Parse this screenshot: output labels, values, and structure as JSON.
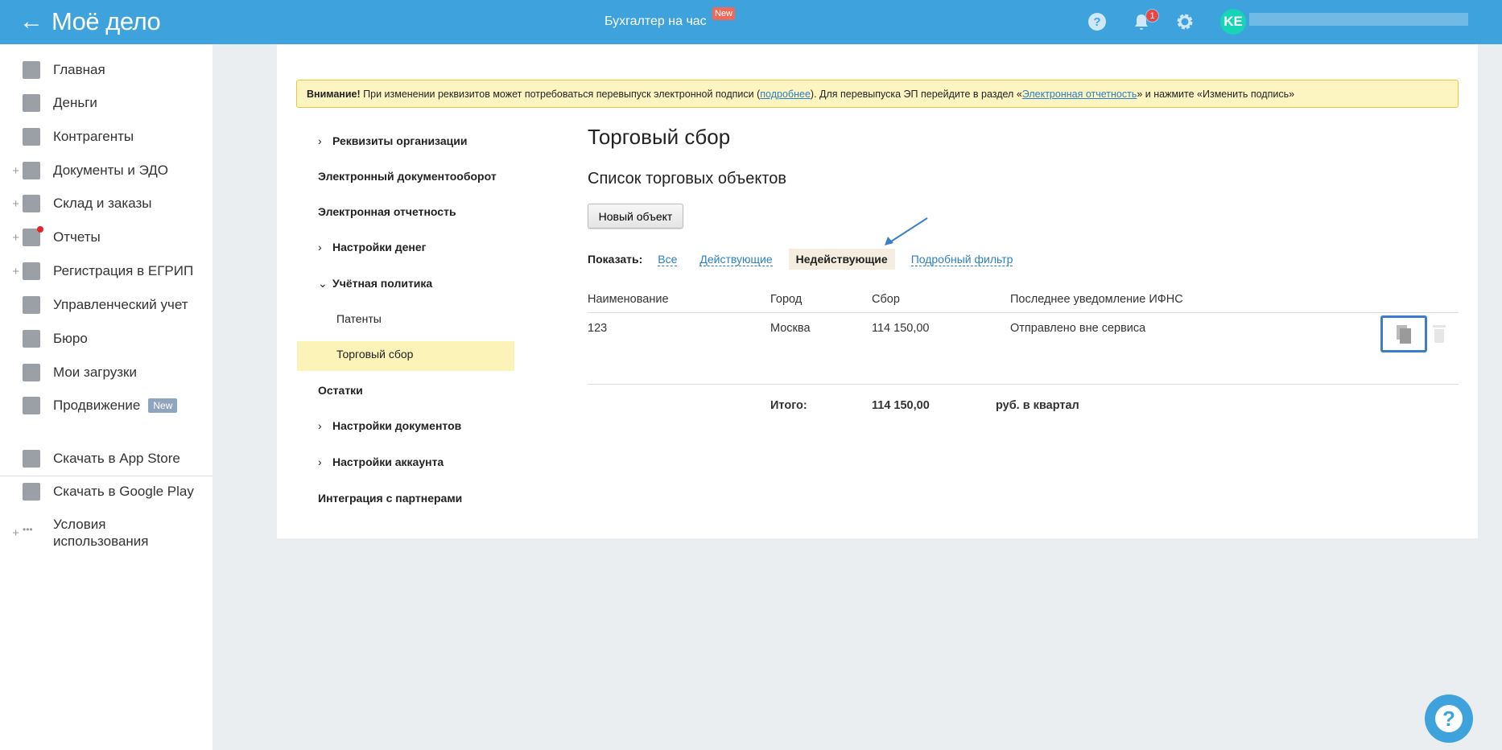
{
  "header": {
    "back": "←",
    "logo": "Моё дело",
    "center_link": "Бухгалтер на час",
    "center_badge": "New",
    "notifications_count": "1",
    "avatar_initials": "KE"
  },
  "sidebar": {
    "items": [
      {
        "label": "Главная",
        "icon": "home-icon",
        "expandable": false
      },
      {
        "label": "Деньги",
        "icon": "money-icon",
        "expandable": false
      },
      {
        "label": "Контрагенты",
        "icon": "contractors-icon",
        "expandable": false
      },
      {
        "label": "Документы и ЭДО",
        "icon": "folder-icon",
        "expandable": true
      },
      {
        "label": "Склад и заказы",
        "icon": "cart-icon",
        "expandable": true
      },
      {
        "label": "Отчеты",
        "icon": "reports-icon",
        "expandable": true
      },
      {
        "label": "Регистрация в ЕГРИП",
        "icon": "registration-icon",
        "expandable": true
      },
      {
        "label": "Управленческий учет",
        "icon": "management-icon",
        "expandable": false
      },
      {
        "label": "Бюро",
        "icon": "briefcase-icon",
        "expandable": false
      },
      {
        "label": "Мои загрузки",
        "icon": "downloads-folder-icon",
        "expandable": false
      },
      {
        "label": "Продвижение",
        "icon": "chart-icon",
        "expandable": false,
        "badge": "New"
      }
    ],
    "bottom": [
      {
        "label": "Скачать в App Store",
        "icon": "apple-icon"
      },
      {
        "label": "Скачать в Google Play",
        "icon": "google-play-icon"
      },
      {
        "label": "Условия использования",
        "icon": "more-icon"
      }
    ],
    "plus": "+"
  },
  "warning": {
    "bold": "Внимание!",
    "text1": " При изменении реквизитов может потребоваться перевыпуск электронной подписи (",
    "link1": "подробнее",
    "text2": "). Для перевыпуска ЭП перейдите в раздел «",
    "link2": "Электронная отчетность",
    "text3": "» и нажмите «Изменить подпись»"
  },
  "settings_menu": [
    {
      "label": "Реквизиты организации",
      "chevron": "›"
    },
    {
      "label": "Электронный документооборот"
    },
    {
      "label": "Электронная отчетность"
    },
    {
      "label": "Настройки денег",
      "chevron": "›"
    },
    {
      "label": "Учётная политика",
      "chevron": "⌄"
    },
    {
      "label": "Патенты",
      "sub": true
    },
    {
      "label": "Торговый сбор",
      "sub": true,
      "active": true
    },
    {
      "label": "Остатки"
    },
    {
      "label": "Настройки документов",
      "chevron": "›"
    },
    {
      "label": "Настройки аккаунта",
      "chevron": "›"
    },
    {
      "label": "Интеграция с партнерами"
    }
  ],
  "main": {
    "title": "Торговый сбор",
    "subtitle": "Список торговых объектов",
    "new_button": "Новый объект",
    "filter": {
      "label": "Показать:",
      "options": [
        "Все",
        "Действующие",
        "Недействующие",
        "Подробный фильтр"
      ],
      "active": "Недействующие"
    },
    "table": {
      "headers": [
        "Наименование",
        "Город",
        "Сбор",
        "Последнее уведомление ИФНС"
      ],
      "rows": [
        [
          "123",
          "Москва",
          "114 150,00",
          "Отправлено вне сервиса"
        ]
      ],
      "total": {
        "label": "Итого:",
        "value": "114 150,00",
        "unit": "руб. в квартал"
      }
    }
  },
  "colors": {
    "header": "#3ea3dd",
    "accent": "#2a7fc4",
    "highlight": "#fbf3b8"
  }
}
